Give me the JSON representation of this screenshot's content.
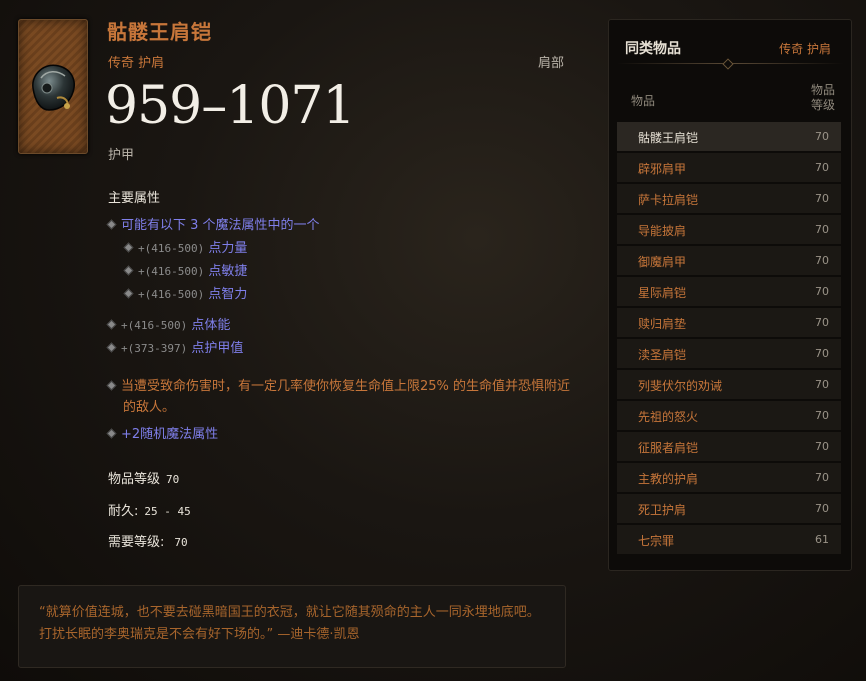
{
  "item": {
    "name": "骷髅王肩铠",
    "subtitle": "传奇 护肩",
    "slot": "肩部",
    "armor_value": "959–1071",
    "armor_label": "护甲",
    "section_title": "主要属性",
    "props": {
      "choose": "可能有以下 3 个魔法属性中的一个",
      "str_range": "+(416-500)",
      "str_text": "点力量",
      "dex_range": "+(416-500)",
      "dex_text": "点敏捷",
      "int_range": "+(416-500)",
      "int_text": "点智力",
      "vit_range": "+(416-500)",
      "vit_text": "点体能",
      "arm_range": "+(373-397)",
      "arm_text": "点护甲值",
      "legendary": "当遭受致命伤害时，有一定几率使你恢复生命值上限25% 的生命值并恐惧附近的敌人。",
      "random": "+2随机魔法属性"
    },
    "item_level_label": "物品等级",
    "item_level_value": "70",
    "durability_label": "耐久:",
    "durability_value": "25 - 45",
    "required_level_label": "需要等级:",
    "required_level_value": "70",
    "flavor": "“就算价值连城，也不要去碰黑暗国王的衣冠，就让它随其殒命的主人一同永埋地底吧。打扰长眠的李奥瑞克是不会有好下场的。” —迪卡德·凯恩"
  },
  "panel": {
    "title": "同类物品",
    "filter": "传奇 护肩",
    "col_item": "物品",
    "col_level_line1": "物品",
    "col_level_line2": "等级",
    "items": [
      {
        "name": "骷髅王肩铠",
        "level": "70"
      },
      {
        "name": "辟邪肩甲",
        "level": "70"
      },
      {
        "name": "萨卡拉肩铠",
        "level": "70"
      },
      {
        "name": "导能披肩",
        "level": "70"
      },
      {
        "name": "御魔肩甲",
        "level": "70"
      },
      {
        "name": "星际肩铠",
        "level": "70"
      },
      {
        "name": "赎归肩垫",
        "level": "70"
      },
      {
        "name": "渎圣肩铠",
        "level": "70"
      },
      {
        "name": "列斐伏尔的劝诫",
        "level": "70"
      },
      {
        "name": "先祖的怒火",
        "level": "70"
      },
      {
        "name": "征服者肩铠",
        "level": "70"
      },
      {
        "name": "主教的护肩",
        "level": "70"
      },
      {
        "name": "死卫护肩",
        "level": "70"
      },
      {
        "name": "七宗罪",
        "level": "61"
      }
    ]
  },
  "colors": {
    "legendary": "#c7763a",
    "magic": "#7f7fea",
    "white": "#f2eee6"
  }
}
